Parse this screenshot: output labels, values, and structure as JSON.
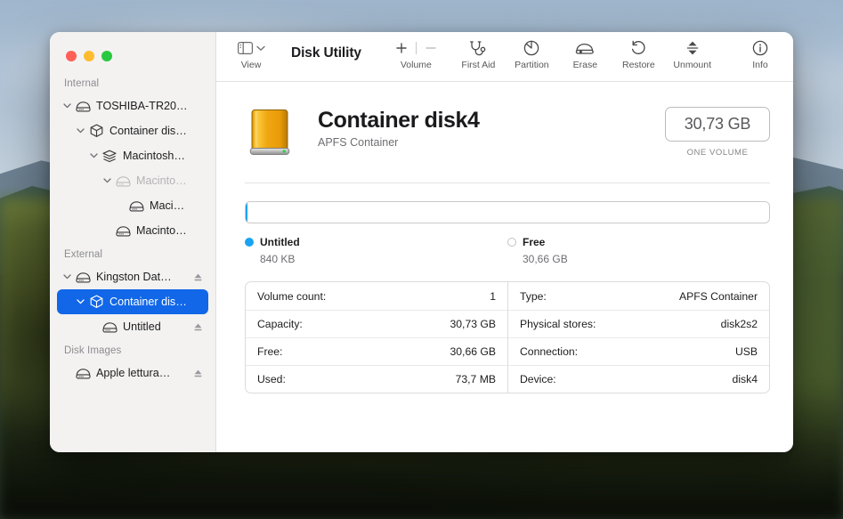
{
  "window": {
    "title": "Disk Utility",
    "traffic_lights": [
      "close",
      "minimize",
      "zoom"
    ]
  },
  "toolbar": {
    "view": {
      "label": "View",
      "icon": "sidebar-toggle-icon"
    },
    "volume": {
      "label": "Volume",
      "add_icon": "plus-icon",
      "remove_icon": "minus-icon"
    },
    "first_aid": {
      "label": "First Aid",
      "icon": "stethoscope-icon"
    },
    "partition": {
      "label": "Partition",
      "icon": "pie-chart-icon"
    },
    "erase": {
      "label": "Erase",
      "icon": "erase-disk-icon"
    },
    "restore": {
      "label": "Restore",
      "icon": "restore-arrow-icon"
    },
    "unmount": {
      "label": "Unmount",
      "icon": "unmount-icon"
    },
    "info": {
      "label": "Info",
      "icon": "info-circle-icon"
    }
  },
  "sidebar": {
    "groups": [
      {
        "title": "Internal",
        "items": [
          {
            "label": "TOSHIBA-TR20…",
            "icon": "hard-drive-icon",
            "indent": 0,
            "twisty": "down",
            "dimmed": false,
            "selected": false,
            "eject": false
          },
          {
            "label": "Container dis…",
            "icon": "container-box-icon",
            "indent": 1,
            "twisty": "down",
            "dimmed": false,
            "selected": false,
            "eject": false
          },
          {
            "label": "Macintosh…",
            "icon": "volume-group-icon",
            "indent": 2,
            "twisty": "down",
            "dimmed": false,
            "selected": false,
            "eject": false
          },
          {
            "label": "Macinto…",
            "icon": "hard-drive-icon",
            "indent": 3,
            "twisty": "down",
            "dimmed": true,
            "selected": false,
            "eject": false
          },
          {
            "label": "Maci…",
            "icon": "hard-drive-icon",
            "indent": 4,
            "twisty": "none",
            "dimmed": false,
            "selected": false,
            "eject": false
          },
          {
            "label": "Macinto…",
            "icon": "hard-drive-icon",
            "indent": 3,
            "twisty": "none",
            "dimmed": false,
            "selected": false,
            "eject": false
          }
        ]
      },
      {
        "title": "External",
        "items": [
          {
            "label": "Kingston Dat…",
            "icon": "hard-drive-icon",
            "indent": 0,
            "twisty": "down",
            "dimmed": false,
            "selected": false,
            "eject": true
          },
          {
            "label": "Container dis…",
            "icon": "container-box-icon",
            "indent": 1,
            "twisty": "down",
            "dimmed": false,
            "selected": true,
            "eject": false
          },
          {
            "label": "Untitled",
            "icon": "hard-drive-icon",
            "indent": 2,
            "twisty": "none",
            "dimmed": false,
            "selected": false,
            "eject": true
          }
        ]
      },
      {
        "title": "Disk Images",
        "items": [
          {
            "label": "Apple lettura…",
            "icon": "hard-drive-icon",
            "indent": 0,
            "twisty": "none",
            "dimmed": false,
            "selected": false,
            "eject": true
          }
        ]
      }
    ]
  },
  "main": {
    "icon": "external-drive-icon",
    "title": "Container disk4",
    "subtitle": "APFS Container",
    "capacity_badge": "30,73 GB",
    "capacity_caption": "ONE VOLUME",
    "usage": {
      "segments": [
        {
          "name": "Untitled",
          "size": "840 KB",
          "color": "#1aa3f0",
          "percent": 0.27
        }
      ],
      "free": {
        "name": "Free",
        "size": "30,66 GB",
        "color": "#ffffff",
        "percent": 99.73
      }
    },
    "info_left": [
      {
        "key": "Volume count:",
        "value": "1"
      },
      {
        "key": "Capacity:",
        "value": "30,73 GB"
      },
      {
        "key": "Free:",
        "value": "30,66 GB"
      },
      {
        "key": "Used:",
        "value": "73,7 MB"
      }
    ],
    "info_right": [
      {
        "key": "Type:",
        "value": "APFS Container"
      },
      {
        "key": "Physical stores:",
        "value": "disk2s2"
      },
      {
        "key": "Connection:",
        "value": "USB"
      },
      {
        "key": "Device:",
        "value": "disk4"
      }
    ]
  },
  "colors": {
    "selection_blue": "#1167e8",
    "untitled_blue": "#1aa3f0",
    "sidebar_bg": "#f3f2f1"
  }
}
